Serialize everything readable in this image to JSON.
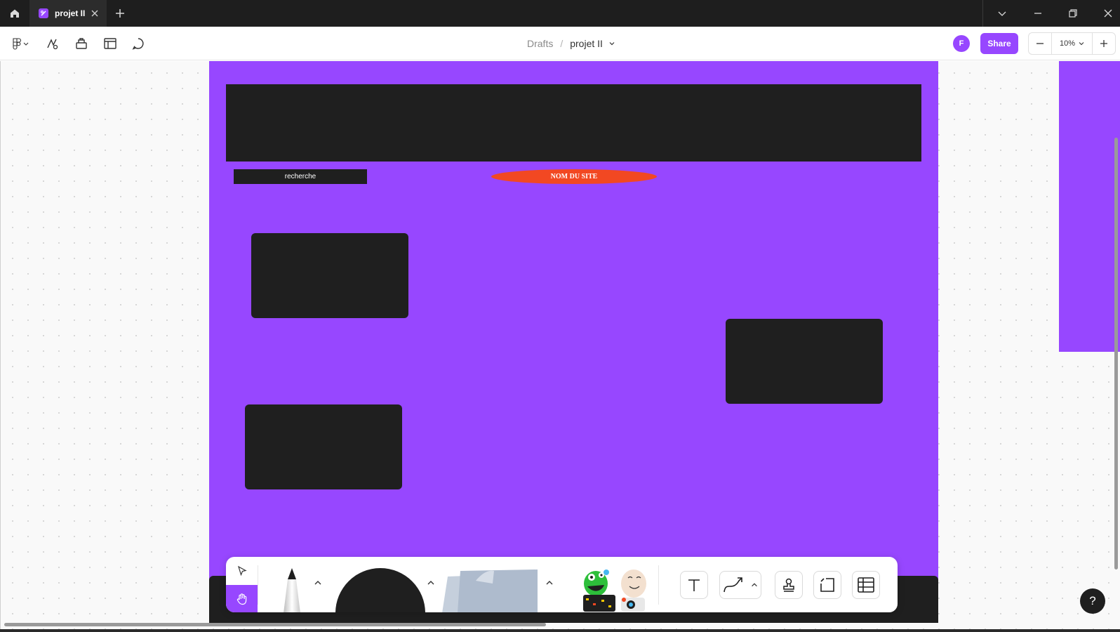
{
  "window": {
    "tab_title": "projet II",
    "colors": {
      "titlebar": "#1e1e1e",
      "accent": "#9747ff"
    }
  },
  "icons": {
    "home": "home-icon",
    "new_tab": "plus-icon",
    "tab_close": "close-icon",
    "window": [
      "chevron-down-icon",
      "minimize-icon",
      "restore-icon",
      "close-icon"
    ],
    "toolbar": [
      "figma-menu-icon",
      "actions-icon",
      "assets-icon",
      "layout-icon",
      "comment-icon"
    ]
  },
  "toolbar": {
    "breadcrumb_root": "Drafts",
    "breadcrumb_sep": "/",
    "file_name": "projet II",
    "avatar_initial": "F",
    "share_label": "Share",
    "zoom_value": "10%"
  },
  "canvas": {
    "colors": {
      "frame": "#9747ff",
      "block": "#1f1f1f",
      "site_name_bg": "#f24822"
    },
    "search_label": "recherche",
    "site_name": "NOM DU SITE"
  },
  "dock": {
    "tools": [
      "select-tool",
      "hand-tool",
      "pencil-tool",
      "shape-tool",
      "sticky-note-tool",
      "sticker-tool",
      "text-tool",
      "connector-tool",
      "stamp-tool",
      "section-tool",
      "table-tool"
    ],
    "active_tool": "hand-tool"
  },
  "help_label": "?"
}
